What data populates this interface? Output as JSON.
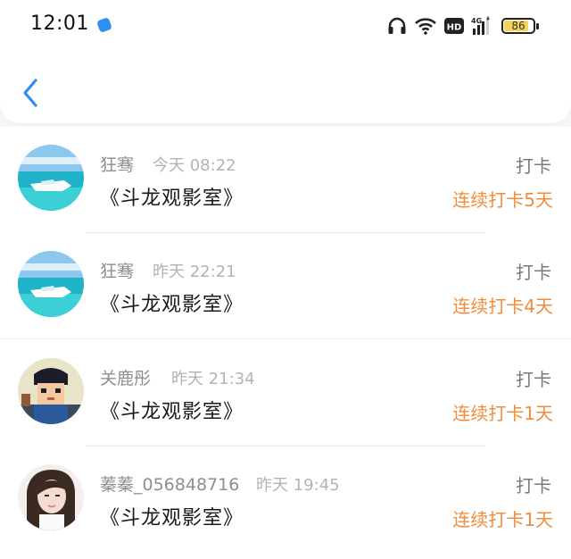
{
  "status_bar": {
    "time": "12:01",
    "network": "HD",
    "cellular": "4G",
    "battery": "86",
    "icons": [
      "headphones-icon",
      "wifi-icon",
      "hd-icon",
      "signal-4g-icon",
      "battery-icon"
    ]
  },
  "header": {
    "back_icon": "chevron-left-icon",
    "accent_color": "#2f8ef0"
  },
  "items": [
    {
      "user": "狂骞",
      "time": "今天 08:22",
      "group": "《斗龙观影室》",
      "action": "打卡",
      "streak": "连续打卡5天",
      "avatar": "ocean-boat"
    },
    {
      "user": "狂骞",
      "time": "昨天 22:21",
      "group": "《斗龙观影室》",
      "action": "打卡",
      "streak": "连续打卡4天",
      "avatar": "ocean-boat"
    },
    {
      "user": "关鹿彤",
      "time": "昨天 21:34",
      "group": "《斗龙观影室》",
      "action": "打卡",
      "streak": "连续打卡1天",
      "avatar": "pixel-character"
    },
    {
      "user": "蓁蓁_056848716",
      "time": "昨天 19:45",
      "group": "《斗龙观影室》",
      "action": "打卡",
      "streak": "连续打卡1天",
      "avatar": "girl-portrait"
    }
  ],
  "colors": {
    "streak": "#f08c3a",
    "name": "#8e8e8e",
    "time": "#b3b3b3"
  }
}
